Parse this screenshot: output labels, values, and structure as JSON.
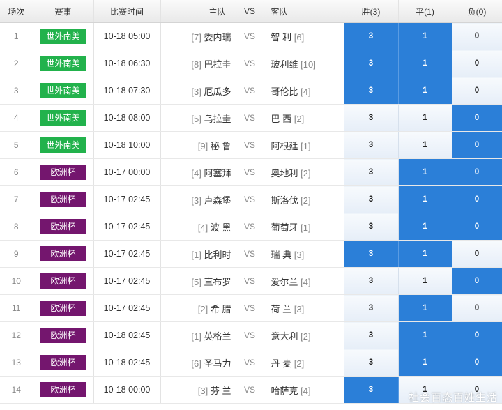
{
  "headers": {
    "idx": "场次",
    "league": "赛事",
    "time": "比赛时间",
    "home": "主队",
    "vs": "VS",
    "away": "客队",
    "win": "胜(3)",
    "draw": "平(1)",
    "lose": "负(0)"
  },
  "colors": {
    "green_badge": "#22b24c",
    "purple_badge": "#74166e",
    "selected": "#2b7fd8"
  },
  "rows": [
    {
      "idx": "1",
      "league": "世外南美",
      "league_color": "green",
      "time": "10-18 05:00",
      "home_rank": "[7]",
      "home": "委内瑞",
      "vs": "VS",
      "away": "智 利",
      "away_rank": "[6]",
      "win": "3",
      "draw": "1",
      "lose": "0",
      "sel": [
        "win",
        "draw"
      ]
    },
    {
      "idx": "2",
      "league": "世外南美",
      "league_color": "green",
      "time": "10-18 06:30",
      "home_rank": "[8]",
      "home": "巴拉圭",
      "vs": "VS",
      "away": "玻利维",
      "away_rank": "[10]",
      "win": "3",
      "draw": "1",
      "lose": "0",
      "sel": [
        "win",
        "draw"
      ]
    },
    {
      "idx": "3",
      "league": "世外南美",
      "league_color": "green",
      "time": "10-18 07:30",
      "home_rank": "[3]",
      "home": "厄瓜多",
      "vs": "VS",
      "away": "哥伦比",
      "away_rank": "[4]",
      "win": "3",
      "draw": "1",
      "lose": "0",
      "sel": [
        "win",
        "draw"
      ]
    },
    {
      "idx": "4",
      "league": "世外南美",
      "league_color": "green",
      "time": "10-18 08:00",
      "home_rank": "[5]",
      "home": "乌拉圭",
      "vs": "VS",
      "away": "巴 西",
      "away_rank": "[2]",
      "win": "3",
      "draw": "1",
      "lose": "0",
      "sel": [
        "lose"
      ]
    },
    {
      "idx": "5",
      "league": "世外南美",
      "league_color": "green",
      "time": "10-18 10:00",
      "home_rank": "[9]",
      "home": "秘 鲁",
      "vs": "VS",
      "away": "阿根廷",
      "away_rank": "[1]",
      "win": "3",
      "draw": "1",
      "lose": "0",
      "sel": [
        "lose"
      ]
    },
    {
      "idx": "6",
      "league": "欧洲杯",
      "league_color": "purple",
      "time": "10-17 00:00",
      "home_rank": "[4]",
      "home": "阿塞拜",
      "vs": "VS",
      "away": "奥地利",
      "away_rank": "[2]",
      "win": "3",
      "draw": "1",
      "lose": "0",
      "sel": [
        "draw",
        "lose"
      ]
    },
    {
      "idx": "7",
      "league": "欧洲杯",
      "league_color": "purple",
      "time": "10-17 02:45",
      "home_rank": "[3]",
      "home": "卢森堡",
      "vs": "VS",
      "away": "斯洛伐",
      "away_rank": "[2]",
      "win": "3",
      "draw": "1",
      "lose": "0",
      "sel": [
        "draw",
        "lose"
      ]
    },
    {
      "idx": "8",
      "league": "欧洲杯",
      "league_color": "purple",
      "time": "10-17 02:45",
      "home_rank": "[4]",
      "home": "波 黑",
      "vs": "VS",
      "away": "葡萄牙",
      "away_rank": "[1]",
      "win": "3",
      "draw": "1",
      "lose": "0",
      "sel": [
        "draw",
        "lose"
      ]
    },
    {
      "idx": "9",
      "league": "欧洲杯",
      "league_color": "purple",
      "time": "10-17 02:45",
      "home_rank": "[1]",
      "home": "比利时",
      "vs": "VS",
      "away": "瑞 典",
      "away_rank": "[3]",
      "win": "3",
      "draw": "1",
      "lose": "0",
      "sel": [
        "win",
        "draw"
      ]
    },
    {
      "idx": "10",
      "league": "欧洲杯",
      "league_color": "purple",
      "time": "10-17 02:45",
      "home_rank": "[5]",
      "home": "直布罗",
      "vs": "VS",
      "away": "爱尔兰",
      "away_rank": "[4]",
      "win": "3",
      "draw": "1",
      "lose": "0",
      "sel": [
        "lose"
      ]
    },
    {
      "idx": "11",
      "league": "欧洲杯",
      "league_color": "purple",
      "time": "10-17 02:45",
      "home_rank": "[2]",
      "home": "希 腊",
      "vs": "VS",
      "away": "荷 兰",
      "away_rank": "[3]",
      "win": "3",
      "draw": "1",
      "lose": "0",
      "sel": [
        "draw"
      ]
    },
    {
      "idx": "12",
      "league": "欧洲杯",
      "league_color": "purple",
      "time": "10-18 02:45",
      "home_rank": "[1]",
      "home": "英格兰",
      "vs": "VS",
      "away": "意大利",
      "away_rank": "[2]",
      "win": "3",
      "draw": "1",
      "lose": "0",
      "sel": [
        "draw",
        "lose"
      ]
    },
    {
      "idx": "13",
      "league": "欧洲杯",
      "league_color": "purple",
      "time": "10-18 02:45",
      "home_rank": "[6]",
      "home": "圣马力",
      "vs": "VS",
      "away": "丹 麦",
      "away_rank": "[2]",
      "win": "3",
      "draw": "1",
      "lose": "0",
      "sel": [
        "draw",
        "lose"
      ]
    },
    {
      "idx": "14",
      "league": "欧洲杯",
      "league_color": "purple",
      "time": "10-18 00:00",
      "home_rank": "[3]",
      "home": "芬 兰",
      "vs": "VS",
      "away": "哈萨克",
      "away_rank": "[4]",
      "win": "3",
      "draw": "1",
      "lose": "0",
      "sel": [
        "win"
      ]
    }
  ],
  "watermark": "社会百态百姓生活"
}
